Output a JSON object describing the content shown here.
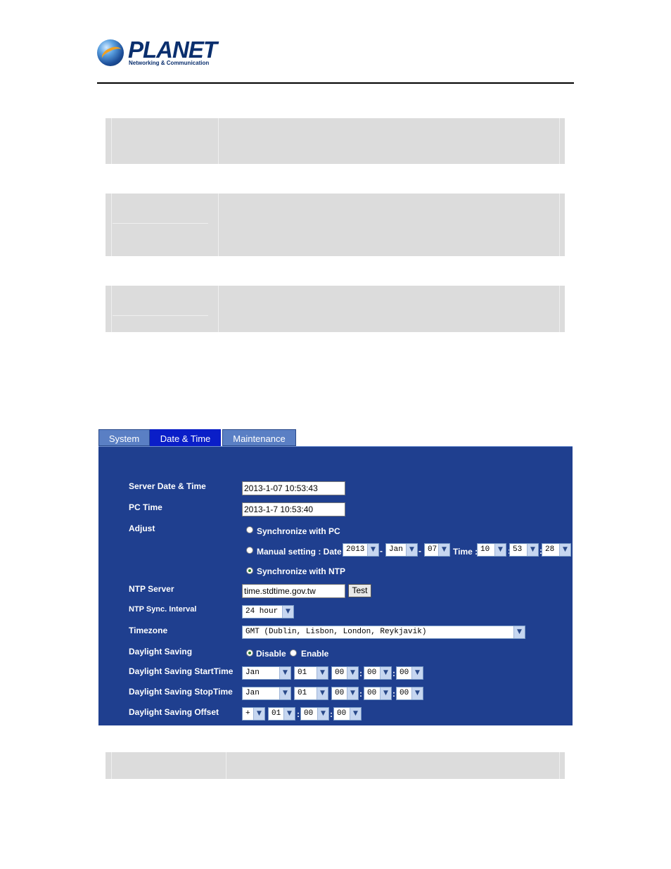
{
  "brand": {
    "name": "PLANET",
    "tagline": "Networking & Communication"
  },
  "tabs": [
    {
      "label": "System",
      "active": false
    },
    {
      "label": "Date & Time",
      "active": true
    },
    {
      "label": "Maintenance",
      "active": false
    }
  ],
  "form": {
    "server_time": {
      "label": "Server Date & Time",
      "value": "2013-1-07 10:53:43"
    },
    "pc_time": {
      "label": "PC Time",
      "value": "2013-1-7 10:53:40"
    },
    "adjust": {
      "label": "Adjust",
      "sync_pc": "Synchronize with PC",
      "manual": "Manual setting : Date :",
      "time_label": "Time :",
      "sync_ntp": "Synchronize with NTP",
      "selected": "sync_ntp",
      "date": {
        "year": "2013",
        "month": "Jan",
        "day": "07"
      },
      "time": {
        "hour": "10",
        "minute": "53",
        "second": "28"
      }
    },
    "ntp_server": {
      "label": "NTP Server",
      "value": "time.stdtime.gov.tw",
      "test_label": "Test"
    },
    "ntp_interval": {
      "label": "NTP Sync. Interval",
      "value": "24 hour"
    },
    "timezone": {
      "label": "Timezone",
      "value": "GMT (Dublin, Lisbon, London, Reykjavik)"
    },
    "daylight": {
      "label": "Daylight Saving",
      "disable": "Disable",
      "enable": "Enable",
      "selected": "disable"
    },
    "dst_start": {
      "label": "Daylight Saving StartTime",
      "month": "Jan",
      "day": "01",
      "hour": "00",
      "minute": "00",
      "second": "00"
    },
    "dst_stop": {
      "label": "Daylight Saving StopTime",
      "month": "Jan",
      "day": "01",
      "hour": "00",
      "minute": "00",
      "second": "00"
    },
    "dst_offset": {
      "label": "Daylight Saving Offset",
      "sign": "+",
      "hour": "01",
      "minute": "00",
      "second": "00"
    }
  },
  "colors": {
    "panel": "#1f3f8f",
    "tab_active": "#0a1ec8",
    "tab_inactive": "#5a7fc4",
    "brand": "#0a2f6e"
  }
}
